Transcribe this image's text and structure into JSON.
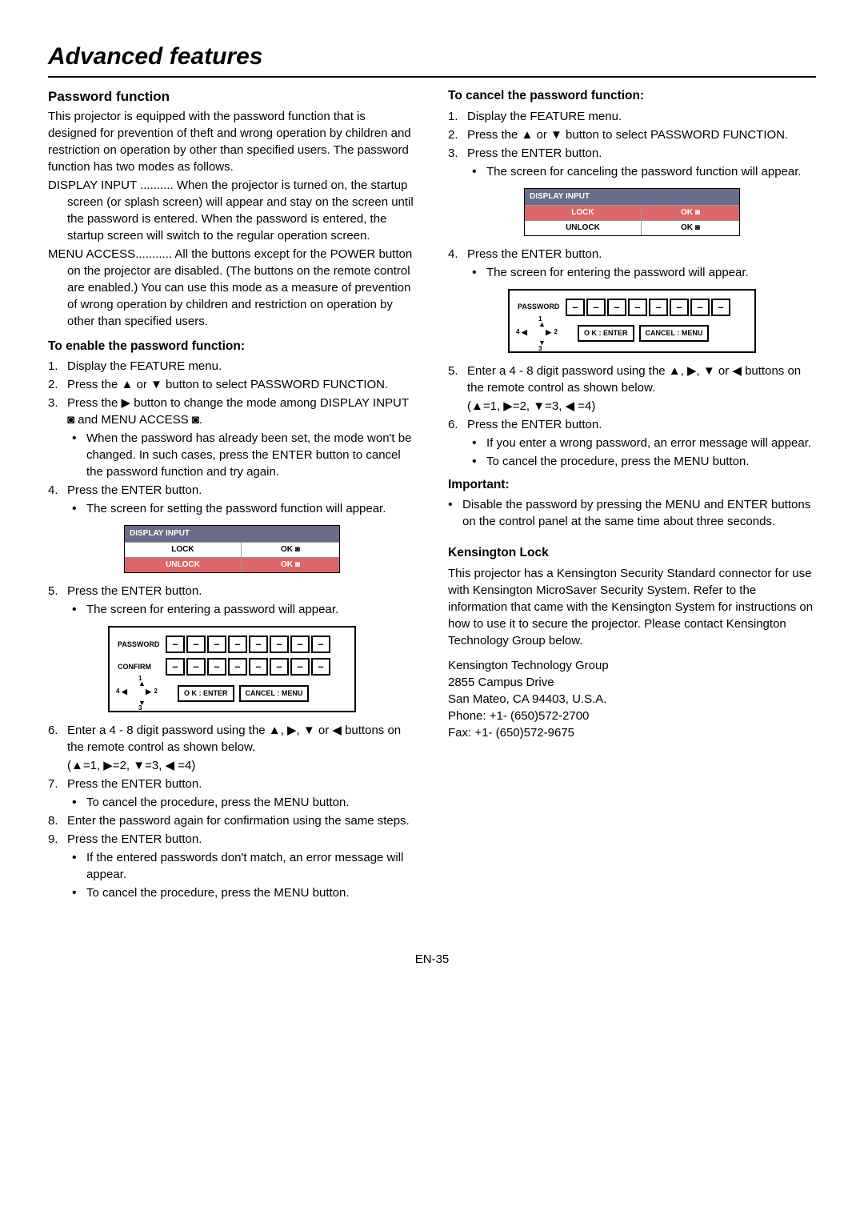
{
  "page_title": "Advanced features",
  "left": {
    "h_pw": "Password function",
    "intro": "This projector is equipped with the password function that is designed for prevention of theft and wrong operation by children and restriction on operation by other than specified users. The password function has two modes as follows.",
    "display_input_desc": "DISPLAY INPUT .......... When the projector is turned on, the startup screen (or splash screen) will appear and stay on the screen until the password is entered. When the password is entered, the startup screen will switch to the regular operation screen.",
    "menu_access_desc": "MENU ACCESS........... All the buttons except for the POWER button on the projector are disabled. (The buttons on the remote control are enabled.) You can use this mode as a measure of prevention of wrong operation by children and restriction on operation by other than specified users.",
    "h_enable": "To enable the password function:",
    "s1": "Display the FEATURE menu.",
    "s2": "Press the ▲ or ▼ button to select PASSWORD FUNCTION.",
    "s3": "Press the ▶ button to change the mode among DISPLAY INPUT ◙ and MENU ACCESS ◙.",
    "s3b": "When the password has already been set, the mode won't be changed. In such cases, press the ENTER button to cancel the password function and try again.",
    "s4": "Press the ENTER button.",
    "s4b": "The screen for setting the password function will appear.",
    "fig1": {
      "hdr": "DISPLAY INPUT",
      "r1a": "LOCK",
      "r1b": "OK ◙",
      "r2a": "UNLOCK",
      "r2b": "OK ◙"
    },
    "s5": "Press the ENTER button.",
    "s5b": "The screen for entering a password will appear.",
    "fig2": {
      "pw": "PASSWORD",
      "cf": "CONFIRM",
      "ok": "O K : ENTER",
      "cancel": "CANCEL : MENU"
    },
    "s6": "Enter a 4 - 8 digit password using the ▲, ▶, ▼ or ◀ buttons on the remote control as shown below.",
    "s6m": "(▲=1, ▶=2, ▼=3, ◀ =4)",
    "s7": "Press the ENTER button.",
    "s7b": "To cancel the procedure, press the MENU button.",
    "s8": "Enter the password again for confirmation using the same steps.",
    "s9": "Press the ENTER button.",
    "s9b1": "If the entered passwords don't match, an error message will appear.",
    "s9b2": "To cancel the procedure, press the MENU button."
  },
  "right": {
    "h_cancel": "To cancel the password function:",
    "c1": "Display the FEATURE menu.",
    "c2": "Press the ▲ or ▼ button to select PASSWORD FUNCTION.",
    "c3": "Press the ENTER button.",
    "c3b": "The screen for canceling the password function will appear.",
    "fig3": {
      "hdr": "DISPLAY INPUT",
      "r1a": "LOCK",
      "r1b": "OK ◙",
      "r2a": "UNLOCK",
      "r2b": "OK ◙"
    },
    "c4": "Press the ENTER button.",
    "c4b": "The screen for entering the password will appear.",
    "fig4": {
      "pw": "PASSWORD",
      "ok": "O K : ENTER",
      "cancel": "CANCEL : MENU"
    },
    "c5": "Enter a 4 - 8 digit password using the ▲, ▶, ▼ or ◀ buttons on the remote control as shown below.",
    "c5m": "(▲=1, ▶=2, ▼=3, ◀ =4)",
    "c6": "Press the ENTER button.",
    "c6b1": "If you enter a wrong password, an error message will appear.",
    "c6b2": "To cancel the procedure, press the MENU button.",
    "h_imp": "Important:",
    "imp": "Disable the password by pressing the MENU and ENTER buttons on the control panel at the same time about three seconds.",
    "h_ken": "Kensington Lock",
    "ken_p": "This projector has a Kensington Security Standard connector for use with Kensington MicroSaver Security System. Refer to the information that came with the Kensington System for instructions on how to use it to secure the projector. Please contact Kensington Technology Group below.",
    "addr1": "Kensington Technology Group",
    "addr2": "2855 Campus Drive",
    "addr3": "San Mateo, CA 94403, U.S.A.",
    "addr4": "Phone: +1- (650)572-2700",
    "addr5": "Fax: +1- (650)572-9675"
  },
  "page_num": "EN-35",
  "nav": {
    "n1": "1",
    "n2": "2",
    "n3": "3",
    "n4": "4"
  },
  "dash": "–"
}
